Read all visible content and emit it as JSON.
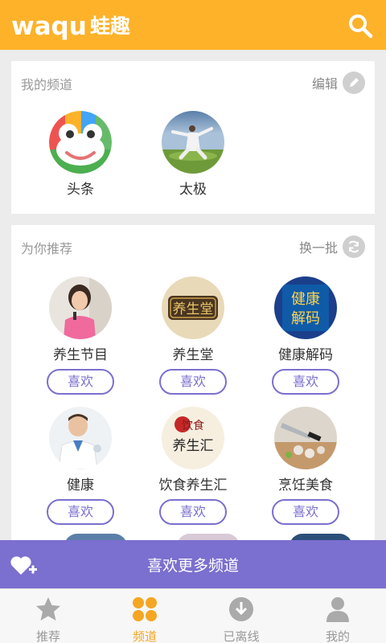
{
  "header": {
    "logo_latin": "waqu",
    "logo_cn": "蛙趣"
  },
  "my_channels": {
    "title": "我的频道",
    "edit_label": "编辑",
    "items": [
      {
        "name": "头条",
        "icon": "frog-logo-icon"
      },
      {
        "name": "太极",
        "icon": "taichi-photo"
      }
    ]
  },
  "recommend": {
    "title": "为你推荐",
    "refresh_label": "换一批",
    "like_label": "喜欢",
    "items": [
      {
        "name": "养生节目"
      },
      {
        "name": "养生堂"
      },
      {
        "name": "健康解码"
      },
      {
        "name": "健康"
      },
      {
        "name": "饮食养生汇"
      },
      {
        "name": "烹饪美食"
      }
    ],
    "thumb_text": {
      "yst": "养生堂",
      "jkjm": [
        "健康",
        "解码"
      ],
      "ys_top": "饮食",
      "ys_bottom": "养生汇"
    }
  },
  "bottom_bar": {
    "label": "喜欢更多频道"
  },
  "tabs": [
    {
      "label": "推荐"
    },
    {
      "label": "频道"
    },
    {
      "label": "已离线"
    },
    {
      "label": "我的"
    }
  ],
  "colors": {
    "brand": "#fdb22a",
    "accent": "#7b6fcf",
    "active_tab": "#f5a623"
  }
}
